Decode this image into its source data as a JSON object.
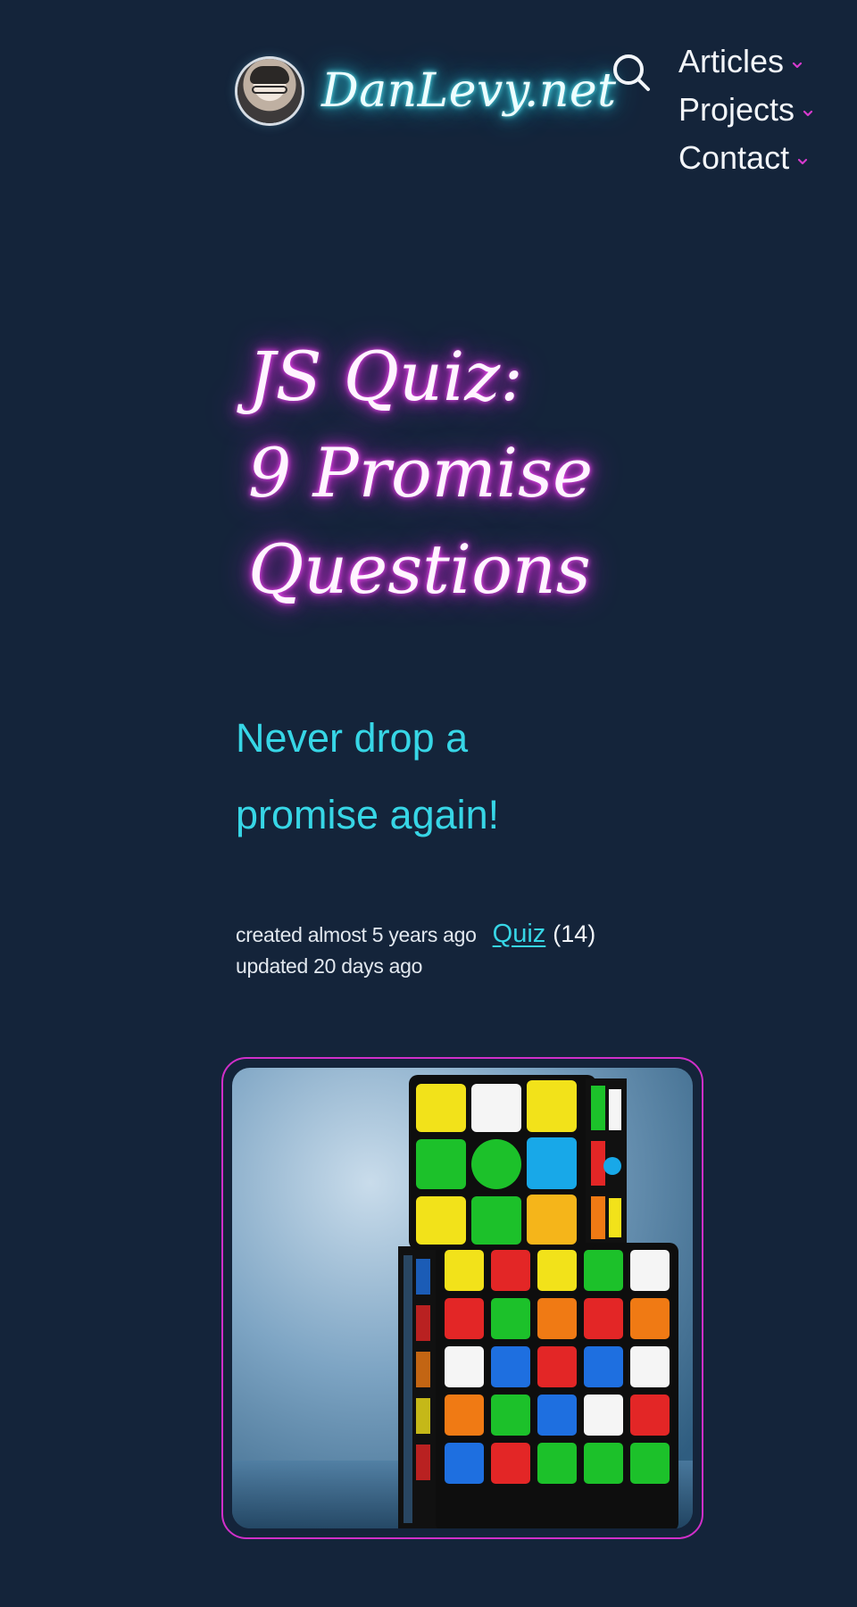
{
  "header": {
    "site_name": "DanLevy.net",
    "avatar_alt": "Dan Levy avatar",
    "search_label": "Search"
  },
  "nav": {
    "items": [
      {
        "label": "Articles",
        "icon": "chevron-down-icon"
      },
      {
        "label": "Projects",
        "icon": "chevron-down-icon"
      },
      {
        "label": "Contact",
        "icon": "chevron-down-icon"
      }
    ]
  },
  "article": {
    "title_lines": [
      "JS Quiz:",
      "9 Promise",
      "Questions"
    ],
    "subtitle_lines": [
      "Never drop a",
      "promise again!"
    ],
    "created": "created almost 5 years ago",
    "updated": "updated 20 days ago",
    "tag": "Quiz",
    "tag_count": "(14)",
    "cover_alt": "Stacked Rubik's cubes"
  },
  "colors": {
    "background": "#14243a",
    "brand_glow": "#2fd3e8",
    "title_glow": "#e02fe0",
    "accent_cyan": "#37d6e6",
    "accent_magenta": "#d02fc9"
  }
}
